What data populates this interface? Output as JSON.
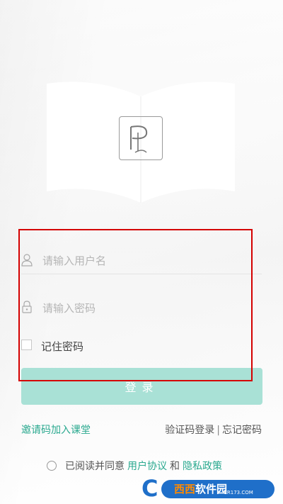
{
  "logo": {
    "icon": "p-logo-icon"
  },
  "login_form": {
    "username_placeholder": "请输入用户名",
    "password_placeholder": "请输入密码",
    "remember_label": "记住密码",
    "login_button": "登录"
  },
  "links": {
    "invite_code": "邀请码加入课堂",
    "sms_login": "验证码登录",
    "separator": "|",
    "forgot_password": "忘记密码"
  },
  "agreement": {
    "prefix": "已阅读并同意",
    "user_agreement": "用户协议",
    "and": "和",
    "privacy_policy": "隐私政策"
  },
  "watermark": {
    "brand": "西西",
    "suffix": "软件园",
    "domain": "CR173.COM"
  },
  "colors": {
    "accent": "#2aa98f",
    "button": "#a9e1d6",
    "highlight_border": "#d40000"
  }
}
